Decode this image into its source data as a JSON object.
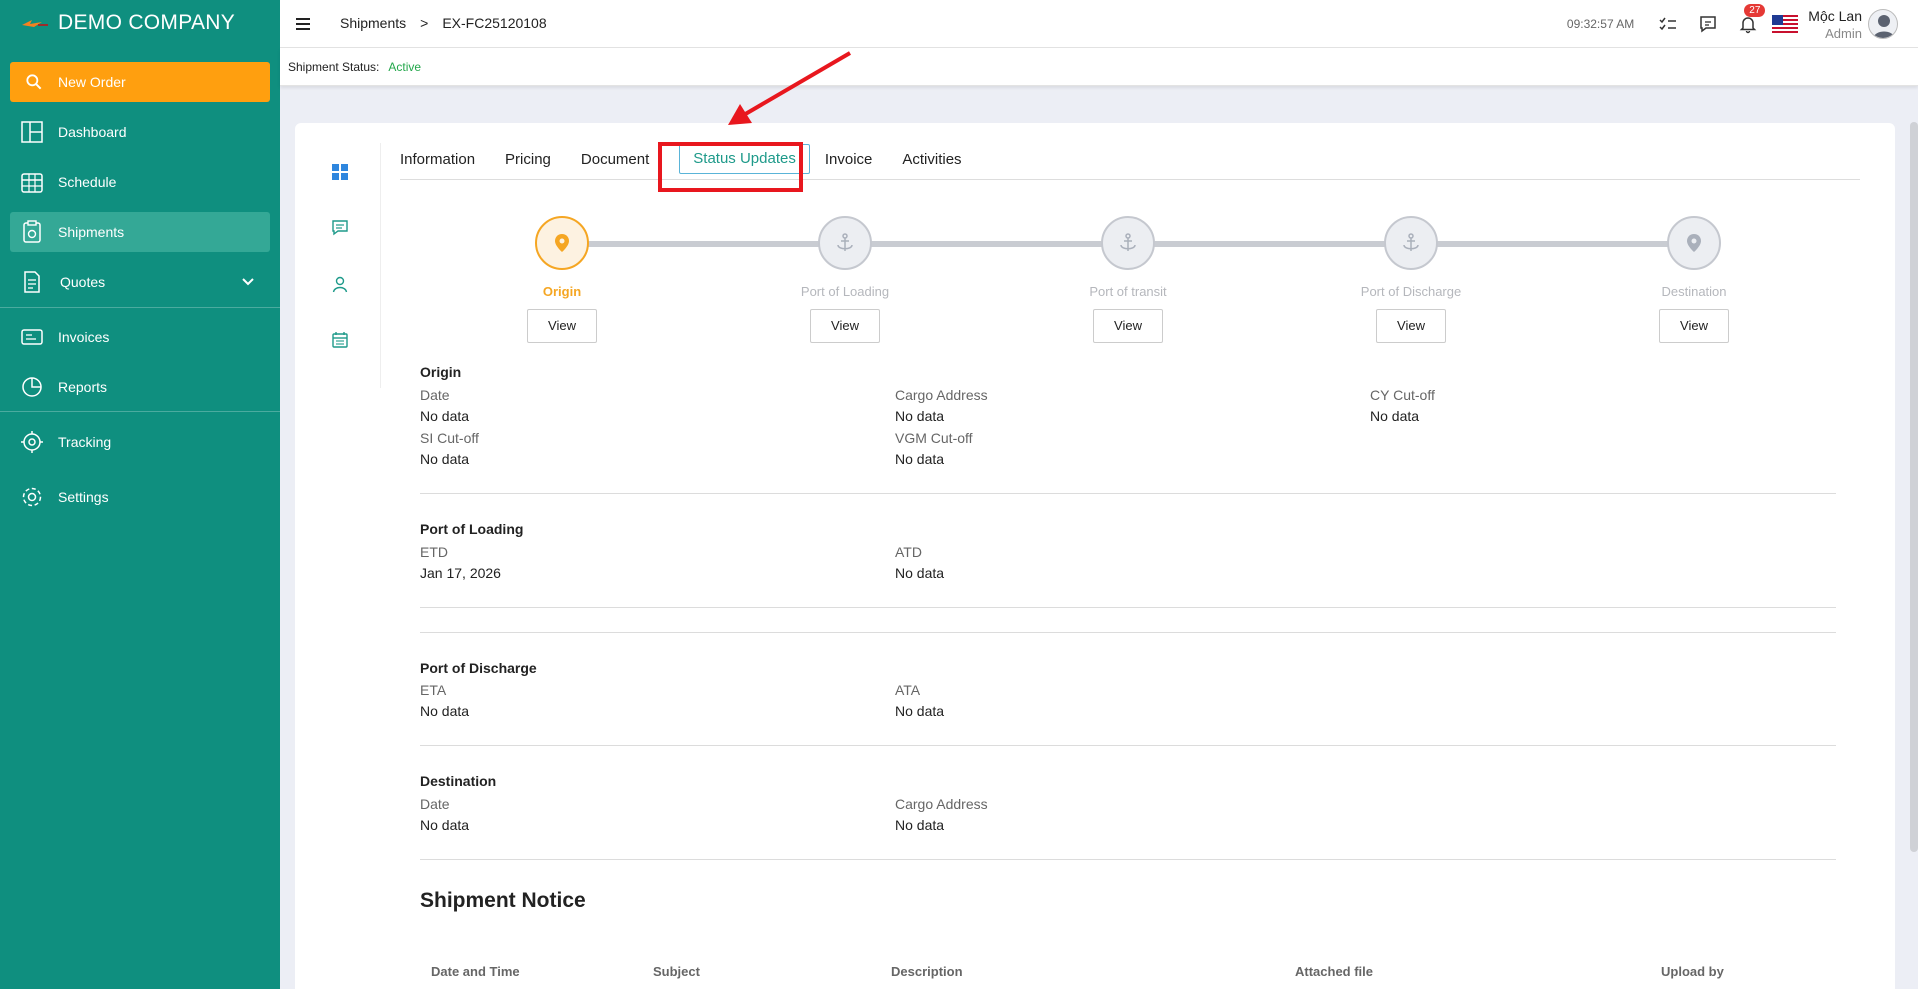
{
  "brand": {
    "name": "DEMO COMPANY"
  },
  "sidebar": {
    "new_order": "New Order",
    "items": [
      {
        "label": "Dashboard"
      },
      {
        "label": "Schedule"
      },
      {
        "label": "Shipments"
      },
      {
        "label": "Quotes"
      },
      {
        "label": "Invoices"
      },
      {
        "label": "Reports"
      },
      {
        "label": "Tracking"
      },
      {
        "label": "Settings"
      }
    ]
  },
  "header": {
    "breadcrumb": [
      "Shipments",
      ">",
      "EX-FC25120108"
    ],
    "time": "09:32:57 AM",
    "notification_count": "27",
    "user_name": "Mộc Lan",
    "user_role": "Admin"
  },
  "status": {
    "label": "Shipment Status:",
    "value": "Active"
  },
  "tabs": [
    "Information",
    "Pricing",
    "Document",
    "Status Updates",
    "Invoice",
    "Activities"
  ],
  "timeline": [
    {
      "label": "Origin",
      "view": "View"
    },
    {
      "label": "Port of Loading",
      "view": "View"
    },
    {
      "label": "Port of transit",
      "view": "View"
    },
    {
      "label": "Port of Discharge",
      "view": "View"
    },
    {
      "label": "Destination",
      "view": "View"
    }
  ],
  "origin": {
    "title": "Origin",
    "date_label": "Date",
    "date_value": "No data",
    "cargo_label": "Cargo Address",
    "cargo_value": "No data",
    "cy_label": "CY Cut-off",
    "cy_value": "No data",
    "si_label": "SI Cut-off",
    "si_value": "No data",
    "vgm_label": "VGM Cut-off",
    "vgm_value": "No data"
  },
  "loading": {
    "title": "Port of Loading",
    "etd_label": "ETD",
    "etd_value": "Jan 17, 2026",
    "atd_label": "ATD",
    "atd_value": "No data"
  },
  "discharge": {
    "title": "Port of Discharge",
    "eta_label": "ETA",
    "eta_value": "No data",
    "ata_label": "ATA",
    "ata_value": "No data"
  },
  "destination": {
    "title": "Destination",
    "date_label": "Date",
    "date_value": "No data",
    "cargo_label": "Cargo Address",
    "cargo_value": "No data"
  },
  "notice": {
    "title": "Shipment Notice",
    "columns": [
      "Date and Time",
      "Subject",
      "Description",
      "Attached file",
      "Upload by"
    ]
  },
  "colors": {
    "sidebar": "#0f8f7f",
    "accent": "#ff9f0f",
    "active_tab": "#1e9a8a",
    "highlight": "#e8171e"
  }
}
